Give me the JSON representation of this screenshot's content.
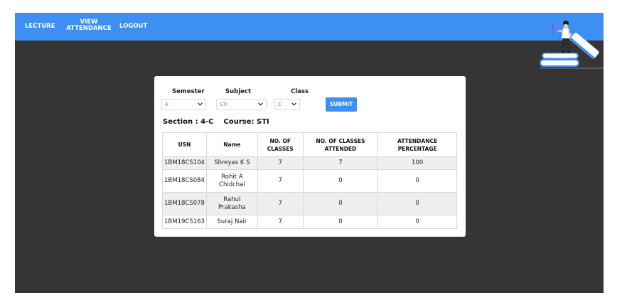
{
  "nav": {
    "lecture": "LECTURE",
    "view_attendance_line1": "VIEW",
    "view_attendance_line2": "ATTENDANCE",
    "logout": "LOGOUT"
  },
  "form": {
    "semester_label": "Semester",
    "subject_label": "Subject",
    "class_label": "Class",
    "semester_value": "4",
    "subject_value": "STI",
    "class_value": "C",
    "submit_label": "SUBMIT"
  },
  "info": {
    "section": "Section : 4-C",
    "course": "Course: STI"
  },
  "table": {
    "headers": {
      "usn": "USN",
      "name": "Name",
      "classes_line1": "NO. OF",
      "classes_line2": "CLASSES",
      "attended_line1": "NO. OF CLASSES",
      "attended_line2": "ATTENDED",
      "percentage_line1": "ATTENDANCE",
      "percentage_line2": "PERCENTAGE"
    },
    "rows": [
      {
        "usn": "1BM18CS104",
        "name_line1": "Shreyas K S",
        "name_line2": "",
        "classes": "7",
        "attended": "7",
        "percentage": "100"
      },
      {
        "usn": "1BM18CS084",
        "name_line1": "Rohit A",
        "name_line2": "Chidchal",
        "classes": "7",
        "attended": "0",
        "percentage": "0"
      },
      {
        "usn": "1BM18CS078",
        "name_line1": "Rahul",
        "name_line2": "Prakasha",
        "classes": "7",
        "attended": "0",
        "percentage": "0"
      },
      {
        "usn": "1BM19CS163",
        "name_line1": "Suraj Nair",
        "name_line2": "",
        "classes": "7",
        "attended": "0",
        "percentage": "0"
      }
    ]
  },
  "colors": {
    "navbar": "#3d8ff2",
    "background": "#353535",
    "accent": "#3d8ff2"
  },
  "icons": {
    "header_illustration": "student-on-books-illustration",
    "select_chevron": "chevron-down-icon"
  }
}
